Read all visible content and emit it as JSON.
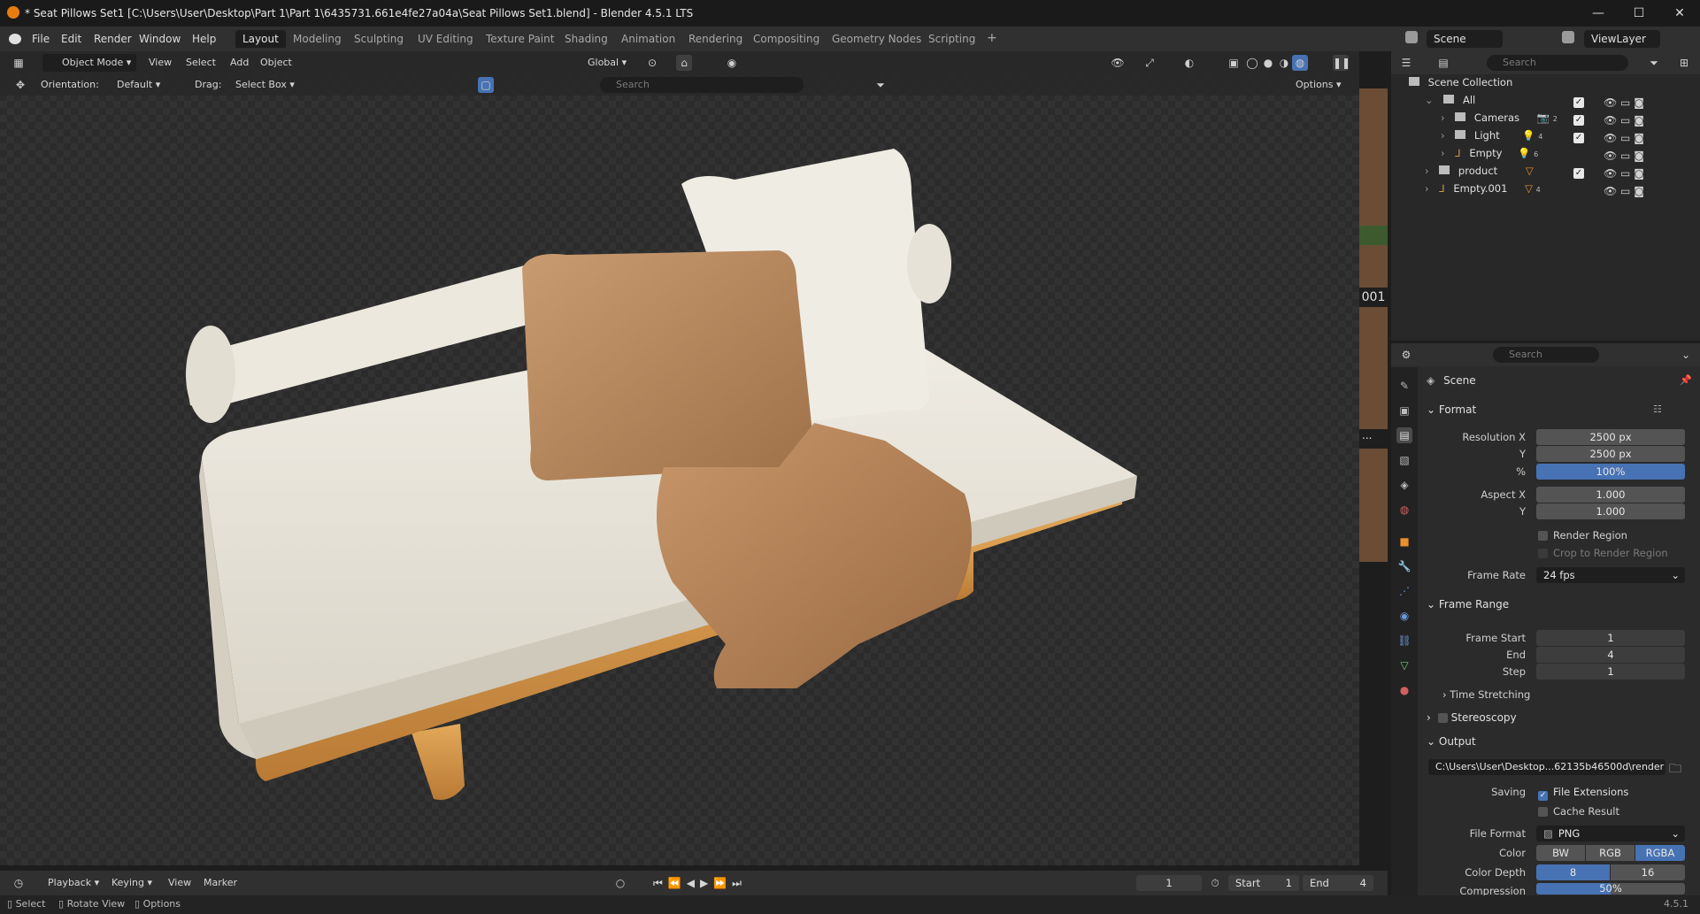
{
  "window": {
    "title": "* Seat Pillows Set1 [C:\\Users\\User\\Desktop\\Part 1\\Part 1\\6435731.661e4fe27a04a\\Seat Pillows Set1.blend] - Blender 4.5.1 LTS",
    "minimize": "—",
    "maximize": "☐",
    "close": "✕"
  },
  "menu": {
    "items": [
      "File",
      "Edit",
      "Render",
      "Window",
      "Help"
    ],
    "workspaces": [
      "Layout",
      "Modeling",
      "Sculpting",
      "UV Editing",
      "Texture Paint",
      "Shading",
      "Animation",
      "Rendering",
      "Compositing",
      "Geometry Nodes",
      "Scripting"
    ],
    "active_workspace": "Layout",
    "add_tab": "+",
    "scene": "Scene",
    "viewlayer": "ViewLayer"
  },
  "viewport_header": {
    "mode": "Object Mode",
    "menus": [
      "View",
      "Select",
      "Add",
      "Object"
    ],
    "transform": "Global"
  },
  "tool_header": {
    "orientation_label": "Orientation:",
    "orientation_value": "Default",
    "drag_label": "Drag:",
    "drag_value": "Select Box",
    "search_placeholder": "Search",
    "options": "Options"
  },
  "side_strip": {
    "label": "001",
    "ellipsis": "..."
  },
  "outliner": {
    "search_placeholder": "Search",
    "root": "Scene Collection",
    "items": [
      {
        "label": "All"
      },
      {
        "label": "Cameras",
        "badge": "2"
      },
      {
        "label": "Light",
        "badge": "4"
      },
      {
        "label": "Empty",
        "badge": "6"
      },
      {
        "label": "product"
      },
      {
        "label": "Empty.001",
        "badge": "4"
      }
    ]
  },
  "properties": {
    "search_placeholder": "Search",
    "context": "Scene",
    "format": {
      "title": "Format",
      "resolution_x_label": "Resolution X",
      "resolution_x": "2500 px",
      "resolution_y_label": "Y",
      "resolution_y": "2500 px",
      "percent_label": "%",
      "percent": "100%",
      "aspect_x_label": "Aspect X",
      "aspect_x": "1.000",
      "aspect_y_label": "Y",
      "aspect_y": "1.000",
      "render_region": "Render Region",
      "crop_region": "Crop to Render Region",
      "frame_rate_label": "Frame Rate",
      "frame_rate": "24 fps"
    },
    "frame_range": {
      "title": "Frame Range",
      "start_label": "Frame Start",
      "start": "1",
      "end_label": "End",
      "end": "4",
      "step_label": "Step",
      "step": "1",
      "time_stretching": "Time Stretching"
    },
    "stereoscopy": "Stereoscopy",
    "output": {
      "title": "Output",
      "path": "C:\\Users\\User\\Desktop...62135b46500d\\render",
      "saving_label": "Saving",
      "file_extensions": "File Extensions",
      "cache_result": "Cache Result",
      "file_format_label": "File Format",
      "file_format": "PNG",
      "color_label": "Color",
      "color_options": [
        "BW",
        "RGB",
        "RGBA"
      ],
      "color_selected": "RGBA",
      "color_depth_label": "Color Depth",
      "color_depth_options": [
        "8",
        "16"
      ],
      "color_depth_selected": "8",
      "compression_label": "Compression",
      "compression": "50%"
    }
  },
  "timeline": {
    "menus": [
      "Playback",
      "Keying",
      "View",
      "Marker"
    ],
    "current_frame": "1",
    "start_label": "Start",
    "start": "1",
    "end_label": "End",
    "end": "4"
  },
  "status": {
    "select": "Select",
    "rotate": "Rotate View",
    "options": "Options",
    "version": "4.5.1"
  },
  "colors": {
    "accent": "#4772b3",
    "cushion": "#e9e5da",
    "pillow_tan": "#b98b62",
    "wood": "#d69a4c"
  }
}
